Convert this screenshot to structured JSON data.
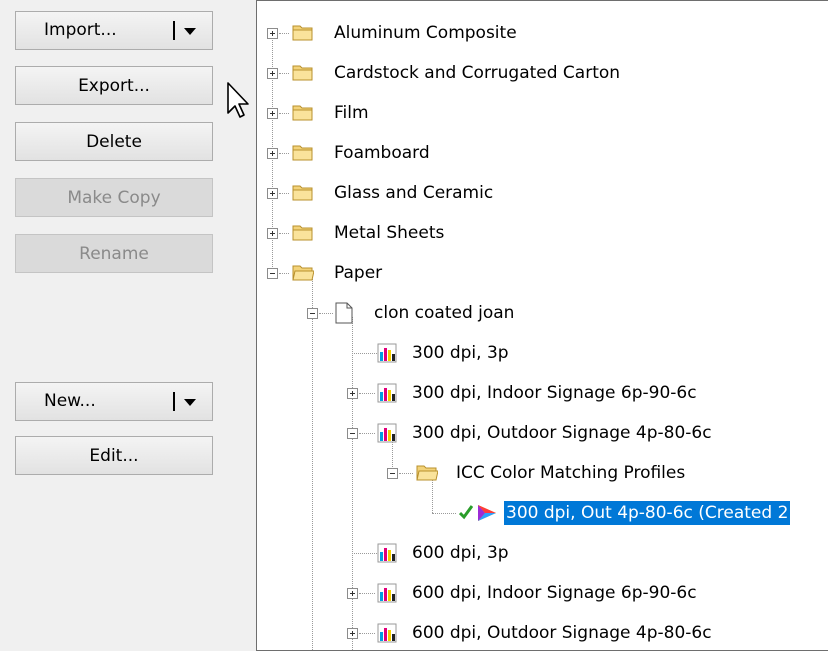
{
  "buttons": {
    "import": "Import...",
    "export": "Export...",
    "delete": "Delete",
    "make_copy": "Make Copy",
    "rename": "Rename",
    "new": "New...",
    "edit": "Edit..."
  },
  "tree": {
    "items": [
      {
        "label": "Aluminum Composite"
      },
      {
        "label": "Cardstock and Corrugated Carton"
      },
      {
        "label": "Film"
      },
      {
        "label": "Foamboard"
      },
      {
        "label": "Glass and Ceramic"
      },
      {
        "label": "Metal Sheets"
      },
      {
        "label": "Paper"
      },
      {
        "label": "clon coated joan"
      },
      {
        "label": "300 dpi, 3p"
      },
      {
        "label": "300 dpi, Indoor Signage 6p-90-6c"
      },
      {
        "label": "300 dpi, Outdoor Signage 4p-80-6c"
      },
      {
        "label": "ICC Color Matching Profiles"
      },
      {
        "label": "300 dpi, Out 4p-80-6c (Created 2"
      },
      {
        "label": "600 dpi, 3p"
      },
      {
        "label": "600 dpi, Indoor Signage 6p-90-6c"
      },
      {
        "label": "600 dpi, Outdoor Signage 4p-80-6c"
      }
    ]
  }
}
